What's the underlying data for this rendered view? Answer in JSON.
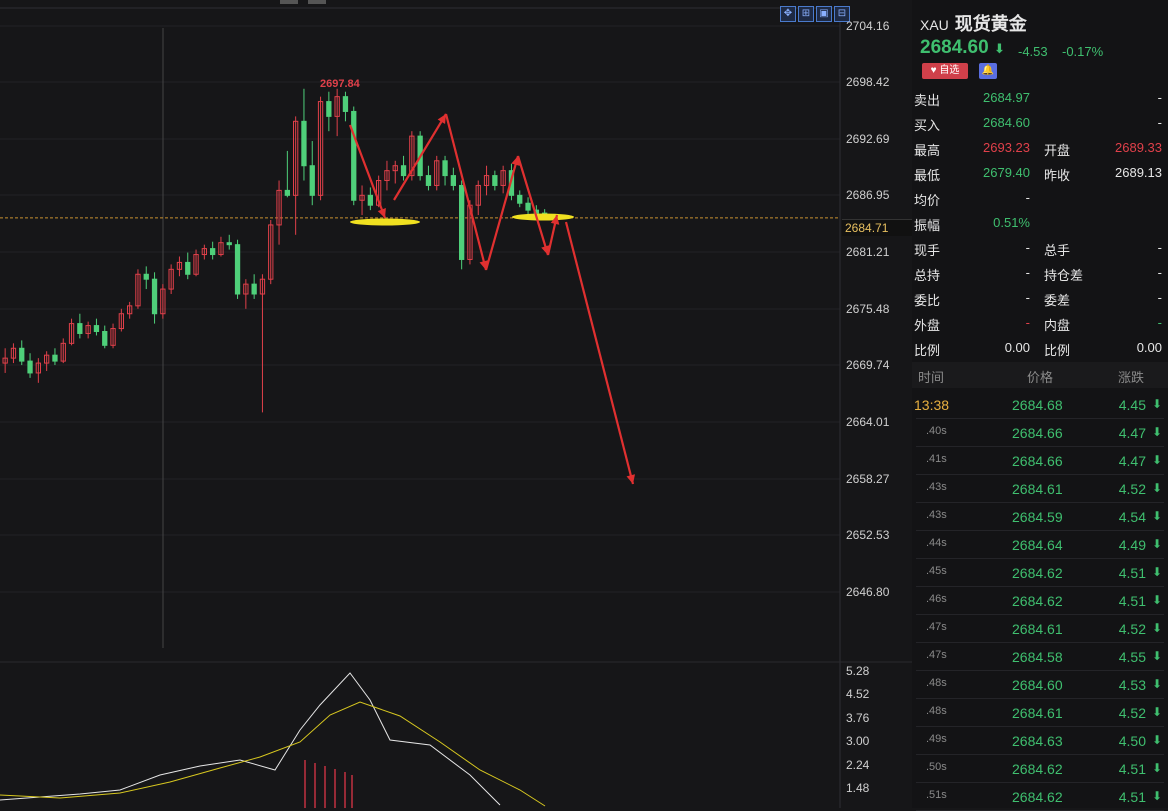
{
  "top_tabs": [
    "",
    ""
  ],
  "toolbar": [
    "✥",
    "⊞",
    "▣",
    "⊟"
  ],
  "axis_labels": [
    "2704.16",
    "2698.42",
    "2692.69",
    "2686.95",
    "2681.21",
    "2675.48",
    "2669.74",
    "2664.01",
    "2658.27",
    "2652.53",
    "2646.80"
  ],
  "current_price_tag": "2684.71",
  "high_marker": "2697.84",
  "sub_axis_labels": [
    "5.28",
    "4.52",
    "3.76",
    "3.00",
    "2.24",
    "1.48"
  ],
  "panel": {
    "code": "XAU",
    "name": "现货黄金",
    "price": "2684.60",
    "arrow": "⬇",
    "change": "-4.53",
    "change_pct": "-0.17%",
    "fav_label": "♥ 自选",
    "bell": "🔔"
  },
  "quotes": [
    {
      "l1": "卖出",
      "v1": "2684.97",
      "c1": "green",
      "l2": "",
      "v2": "-",
      "c2": "white"
    },
    {
      "l1": "买入",
      "v1": "2684.60",
      "c1": "green",
      "l2": "",
      "v2": "-",
      "c2": "white"
    },
    {
      "l1": "最高",
      "v1": "2693.23",
      "c1": "red",
      "l2": "开盘",
      "v2": "2689.33",
      "c2": "red"
    },
    {
      "l1": "最低",
      "v1": "2679.40",
      "c1": "green",
      "l2": "昨收",
      "v2": "2689.13",
      "c2": "white"
    },
    {
      "l1": "均价",
      "v1": "-",
      "c1": "white",
      "l2": "",
      "v2": "",
      "c2": "white"
    },
    {
      "l1": "振幅",
      "v1": "0.51%",
      "c1": "green",
      "l2": "",
      "v2": "",
      "c2": "white"
    },
    {
      "l1": "现手",
      "v1": "-",
      "c1": "white",
      "l2": "总手",
      "v2": "-",
      "c2": "white"
    },
    {
      "l1": "总持",
      "v1": "-",
      "c1": "white",
      "l2": "持仓差",
      "v2": "-",
      "c2": "white"
    },
    {
      "l1": "委比",
      "v1": "-",
      "c1": "white",
      "l2": "委差",
      "v2": "-",
      "c2": "white"
    },
    {
      "l1": "外盘",
      "v1": "-",
      "c1": "red",
      "l2": "内盘",
      "v2": "-",
      "c2": "green"
    },
    {
      "l1": "比例",
      "v1": "0.00",
      "c1": "white",
      "l2": "比例",
      "v2": "0.00",
      "c2": "white"
    }
  ],
  "ticks_header": {
    "time": "时间",
    "price": "价格",
    "change": "涨跌"
  },
  "ticks": [
    {
      "t": "13:38",
      "p": "2684.68",
      "c": "4.45"
    },
    {
      "t": ".40s",
      "p": "2684.66",
      "c": "4.47"
    },
    {
      "t": ".41s",
      "p": "2684.66",
      "c": "4.47"
    },
    {
      "t": ".43s",
      "p": "2684.61",
      "c": "4.52"
    },
    {
      "t": ".43s",
      "p": "2684.59",
      "c": "4.54"
    },
    {
      "t": ".44s",
      "p": "2684.64",
      "c": "4.49"
    },
    {
      "t": ".45s",
      "p": "2684.62",
      "c": "4.51"
    },
    {
      "t": ".46s",
      "p": "2684.62",
      "c": "4.51"
    },
    {
      "t": ".47s",
      "p": "2684.61",
      "c": "4.52"
    },
    {
      "t": ".47s",
      "p": "2684.58",
      "c": "4.55"
    },
    {
      "t": ".48s",
      "p": "2684.60",
      "c": "4.53"
    },
    {
      "t": ".48s",
      "p": "2684.61",
      "c": "4.52"
    },
    {
      "t": ".49s",
      "p": "2684.63",
      "c": "4.50"
    },
    {
      "t": ".50s",
      "p": "2684.62",
      "c": "4.51"
    },
    {
      "t": ".51s",
      "p": "2684.62",
      "c": "4.51"
    }
  ],
  "tick_arrow": "⬇",
  "chart_data": {
    "type": "candlestick",
    "ylim": [
      2644.0,
      2705.0
    ],
    "candles": [
      [
        2670.0,
        2671.5,
        2669.0,
        2670.5
      ],
      [
        2670.5,
        2672.0,
        2670.0,
        2671.5
      ],
      [
        2671.5,
        2672.3,
        2669.8,
        2670.2
      ],
      [
        2670.2,
        2671.0,
        2668.5,
        2669.0
      ],
      [
        2669.0,
        2670.5,
        2668.0,
        2670.0
      ],
      [
        2670.0,
        2671.2,
        2669.2,
        2670.8
      ],
      [
        2670.8,
        2671.5,
        2669.8,
        2670.2
      ],
      [
        2670.2,
        2672.5,
        2670.0,
        2672.0
      ],
      [
        2672.0,
        2674.5,
        2671.8,
        2674.0
      ],
      [
        2674.0,
        2675.0,
        2672.5,
        2673.0
      ],
      [
        2673.0,
        2674.2,
        2672.5,
        2673.8
      ],
      [
        2673.8,
        2674.5,
        2672.8,
        2673.2
      ],
      [
        2673.2,
        2673.8,
        2671.5,
        2671.8
      ],
      [
        2671.8,
        2674.0,
        2671.5,
        2673.5
      ],
      [
        2673.5,
        2675.5,
        2673.2,
        2675.0
      ],
      [
        2675.0,
        2676.2,
        2674.5,
        2675.8
      ],
      [
        2675.8,
        2679.5,
        2675.5,
        2679.0
      ],
      [
        2679.0,
        2679.8,
        2677.5,
        2678.5
      ],
      [
        2678.5,
        2679.2,
        2674.0,
        2675.0
      ],
      [
        2675.0,
        2678.0,
        2674.5,
        2677.5
      ],
      [
        2677.5,
        2680.0,
        2677.0,
        2679.5
      ],
      [
        2679.5,
        2680.8,
        2678.8,
        2680.2
      ],
      [
        2680.2,
        2681.2,
        2678.5,
        2679.0
      ],
      [
        2679.0,
        2681.5,
        2678.8,
        2681.0
      ],
      [
        2681.0,
        2682.0,
        2680.5,
        2681.6
      ],
      [
        2681.6,
        2682.3,
        2680.5,
        2681.0
      ],
      [
        2681.0,
        2682.8,
        2680.8,
        2682.2
      ],
      [
        2682.2,
        2683.0,
        2681.5,
        2682.0
      ],
      [
        2682.0,
        2682.5,
        2676.5,
        2677.0
      ],
      [
        2677.0,
        2678.5,
        2675.5,
        2678.0
      ],
      [
        2678.0,
        2679.0,
        2676.5,
        2677.0
      ],
      [
        2677.0,
        2679.0,
        2665.0,
        2678.5
      ],
      [
        2678.5,
        2684.5,
        2678.0,
        2684.0
      ],
      [
        2684.0,
        2688.5,
        2682.0,
        2687.5
      ],
      [
        2687.5,
        2691.5,
        2686.8,
        2687.0
      ],
      [
        2687.0,
        2695.0,
        2683.0,
        2694.5
      ],
      [
        2694.5,
        2697.8,
        2688.5,
        2690.0
      ],
      [
        2690.0,
        2692.5,
        2686.0,
        2687.0
      ],
      [
        2687.0,
        2697.0,
        2686.5,
        2696.5
      ],
      [
        2696.5,
        2697.5,
        2693.5,
        2695.0
      ],
      [
        2695.0,
        2697.8,
        2693.0,
        2697.0
      ],
      [
        2697.0,
        2697.5,
        2694.5,
        2695.5
      ],
      [
        2695.5,
        2696.0,
        2686.0,
        2686.5
      ],
      [
        2686.5,
        2688.0,
        2685.0,
        2687.0
      ],
      [
        2687.0,
        2687.8,
        2685.5,
        2686.0
      ],
      [
        2686.0,
        2689.0,
        2685.8,
        2688.5
      ],
      [
        2688.5,
        2690.5,
        2687.5,
        2689.5
      ],
      [
        2689.5,
        2690.5,
        2688.2,
        2690.0
      ],
      [
        2690.0,
        2691.0,
        2688.5,
        2689.0
      ],
      [
        2689.0,
        2693.5,
        2688.5,
        2693.0
      ],
      [
        2693.0,
        2693.5,
        2688.5,
        2689.0
      ],
      [
        2689.0,
        2690.0,
        2687.5,
        2688.0
      ],
      [
        2688.0,
        2691.0,
        2687.5,
        2690.5
      ],
      [
        2690.5,
        2691.0,
        2688.0,
        2689.0
      ],
      [
        2689.0,
        2689.8,
        2687.5,
        2688.0
      ],
      [
        2688.0,
        2688.5,
        2679.5,
        2680.5
      ],
      [
        2680.5,
        2686.5,
        2680.0,
        2686.0
      ],
      [
        2686.0,
        2688.5,
        2685.0,
        2688.0
      ],
      [
        2688.0,
        2690.0,
        2687.0,
        2689.0
      ],
      [
        2689.0,
        2689.5,
        2687.5,
        2688.0
      ],
      [
        2688.0,
        2690.0,
        2687.2,
        2689.5
      ],
      [
        2689.5,
        2690.2,
        2686.5,
        2687.0
      ],
      [
        2687.0,
        2687.5,
        2685.8,
        2686.2
      ],
      [
        2686.2,
        2686.8,
        2685.0,
        2685.5
      ],
      [
        2685.5,
        2686.0,
        2684.8,
        2685.2
      ],
      [
        2685.2,
        2685.6,
        2684.6,
        2684.9
      ]
    ]
  }
}
